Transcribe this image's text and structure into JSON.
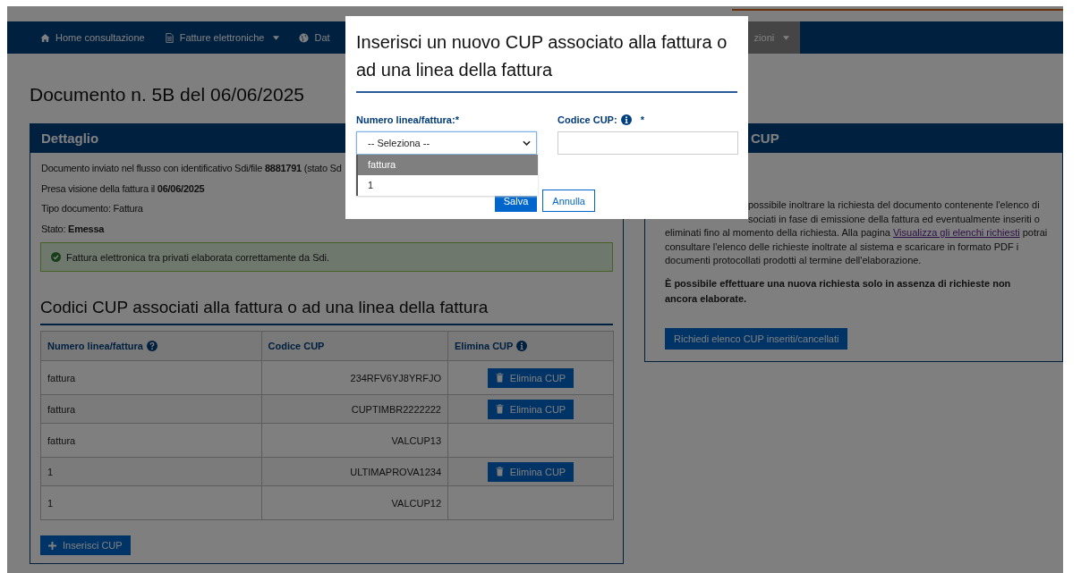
{
  "nav": {
    "items": [
      {
        "label": "Home consultazione",
        "kind": "home",
        "dropdown": false,
        "selected": false
      },
      {
        "label": "Fatture elettroniche",
        "kind": "document",
        "dropdown": true,
        "selected": false
      },
      {
        "label": "Dat",
        "kind": "globe",
        "dropdown": false,
        "selected": false
      },
      {
        "label": "zioni",
        "kind": "plain",
        "dropdown": true,
        "selected": true
      }
    ]
  },
  "page_title": "Documento n. 5B del 06/06/2025",
  "detail": {
    "title": "Dettaglio",
    "lines": [
      "Documento inviato nel flusso con identificativo Sdi/file **8881791** (stato Sd",
      "Presa visione della fattura il **06/06/2025**",
      "Tipo documento: Fattura",
      "Stato: **Emessa**"
    ],
    "alert": "Fattura elettronica tra privati elaborata correttamente da Sdi."
  },
  "cup_section": {
    "title": "Codici CUP associati alla fattura o ad una linea della fattura",
    "columns": [
      {
        "label": "Numero linea/fattura",
        "kind": "help"
      },
      {
        "label": "Codice CUP",
        "kind": "plain"
      },
      {
        "label": "Elimina CUP",
        "kind": "info"
      }
    ],
    "rows": [
      {
        "line": "fattura",
        "code": "234RFV6YJ8YRFJO",
        "delete_button": "Elimina CUP"
      },
      {
        "line": "fattura",
        "code": "CUPTIMBR2222222",
        "delete_button": "Elimina CUP"
      },
      {
        "line": "fattura",
        "code": "VALCUP13"
      },
      {
        "line": "1",
        "code": "ULTIMAPROVA1234",
        "delete_button": "Elimina CUP"
      },
      {
        "line": "1",
        "code": "VALCUP12"
      }
    ],
    "insert_button": "Inserisci CUP"
  },
  "request_panel": {
    "title": "CUP",
    "lines": [
      {
        "text": "possibile inoltrare la richiesta del documento contenente l'elenco di",
        "kind": "partial"
      },
      {
        "text": "sociati in fase di emissione della fattura ed eventualmente inseriti o",
        "kind": "partial"
      },
      {
        "text": "eliminati fino al momento della richiesta. Alla pagina ",
        "link": "Visualizza gli elenchi richiesti",
        "after": " potrai",
        "kind": "link"
      },
      {
        "text": "consultare l'elenco delle richieste inoltrate al sistema e scaricare in formato PDF i",
        "kind": "full"
      },
      {
        "text": "documenti protocollati prodotti al termine dell'elaborazione.",
        "kind": "full"
      }
    ],
    "note": "È possibile effettuare una nuova richiesta solo in assenza di richieste non ancora elaborate.",
    "button": "Richiedi elenco CUP inseriti/cancellati"
  },
  "modal": {
    "title": "Inserisci un nuovo CUP associato alla fattura o ad una linea della fattura",
    "line_label": "Numero linea/fattura:*",
    "line_select": {
      "value": "-- Seleziona --",
      "options": [
        {
          "label": "fattura",
          "selected": true
        },
        {
          "label": "1",
          "selected": false
        }
      ]
    },
    "cup_label": "Codice CUP:",
    "cup_required": "*",
    "save": "Salva",
    "cancel": "Annulla"
  }
}
